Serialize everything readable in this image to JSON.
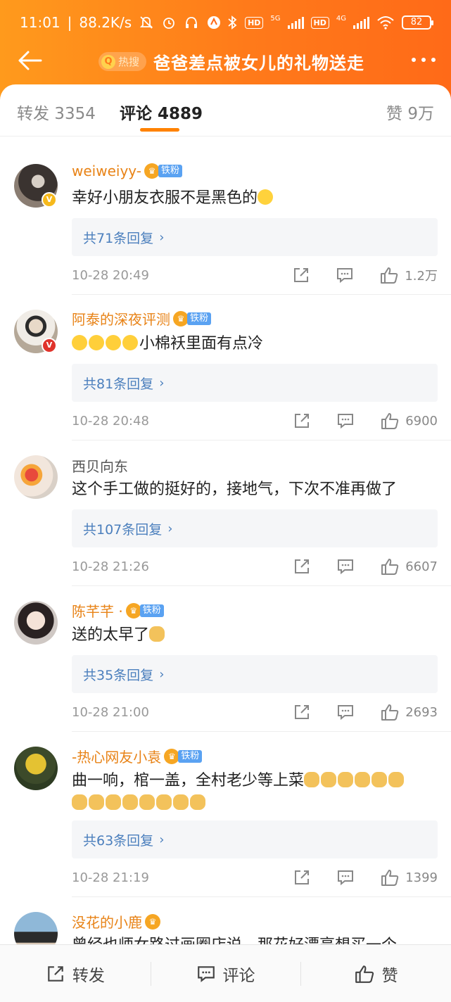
{
  "status_bar": {
    "time": "11:01",
    "speed": "88.2K/s",
    "hd1": "HD",
    "net1": "5G",
    "hd2": "HD",
    "net2": "4G",
    "battery": "82"
  },
  "header": {
    "hot_label": "热搜",
    "title": "爸爸差点被女儿的礼物送走"
  },
  "tabs": {
    "repost": "转发 3354",
    "comment": "评论 4889",
    "like": "赞 9万"
  },
  "fan_label": "铁粉",
  "comments": [
    {
      "name": "weiweiyy-",
      "text": "幸好小朋友衣服不是黑色的",
      "replies": "共71条回复",
      "time": "10-28 20:49",
      "likes": "1.2万"
    },
    {
      "name": "阿泰的深夜评测",
      "text": "小棉袄里面有点冷",
      "replies": "共81条回复",
      "time": "10-28 20:48",
      "likes": "6900"
    },
    {
      "name": "西贝向东",
      "text": "这个手工做的挺好的，接地气，下次不准再做了",
      "replies": "共107条回复",
      "time": "10-28 21:26",
      "likes": "6607"
    },
    {
      "name": "陈芊芊 ·",
      "text": "送的太早了",
      "replies": "共35条回复",
      "time": "10-28 21:00",
      "likes": "2693"
    },
    {
      "name": "-热心网友小袁",
      "text": "曲一响，棺一盖，全村老少等上菜",
      "replies": "共63条回复",
      "time": "10-28 21:19",
      "likes": "1399"
    },
    {
      "name": "没花的小鹿",
      "text": "曾经也师女路过画圈店说，那花好漂亮想买一个"
    }
  ],
  "bottom_bar": {
    "repost": "转发",
    "comment": "评论",
    "like": "赞"
  },
  "colors": {
    "header_orange": "#ff7a1a",
    "accent": "#ff8200",
    "username_orange": "#e88317",
    "link_blue": "#4b7fbd"
  }
}
